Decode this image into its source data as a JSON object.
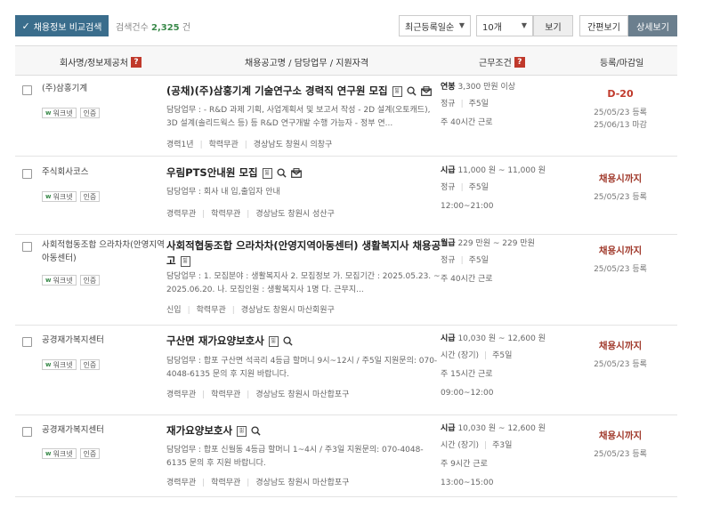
{
  "toolbar": {
    "compare_button": "채용정보 비교검색",
    "count_label": "검색건수",
    "count_value": "2,325",
    "count_unit": "건",
    "sort_select": "최근등록일순",
    "per_page_select": "10개",
    "view_button": "보기",
    "simple_view": "간편보기",
    "detail_view": "상세보기"
  },
  "headers": {
    "company": "회사명/정보제공처",
    "title": "채용공고명 / 담당업무 / 지원자격",
    "conditions": "근무조건",
    "dates": "등록/마감일",
    "help": "?"
  },
  "badges": {
    "worknet": "워크넷",
    "cert": "인증",
    "worknet_mark": "w",
    "doc_mark": "핆"
  },
  "rows": [
    {
      "company": "(주)삼홍기계",
      "title": "(공채)(주)삼홍기계 기술연구소 경력직 연구원 모집",
      "duty": "담당업무 : - R&D 과제 기획, 사업계획서 및 보고서 작성 - 2D 설계(오토캐드), 3D 설계(솔리드웍스 등) 등 R&D 연구개발 수행 가능자 - 정부 연...",
      "meta": [
        "경력1년",
        "학력무관",
        "경상남도 창원시 의창구"
      ],
      "pay_type": "연봉",
      "pay": "3,300 만원 이상",
      "lines": [
        [
          "정규",
          "주5일"
        ],
        [
          "주 40시간 근로"
        ]
      ],
      "status": "D-20",
      "reg": "25/05/23 등록",
      "close": "25/06/13 마감"
    },
    {
      "company": "주식회사코스",
      "title": "우림PTS안내원 모집",
      "duty": "담당업무 : 회사 내 입,출입자 안내",
      "meta": [
        "경력무관",
        "학력무관",
        "경상남도 창원시 성산구"
      ],
      "pay_type": "시급",
      "pay": "11,000 원 ~ 11,000 원",
      "lines": [
        [
          "정규",
          "주5일"
        ],
        [
          "12:00~21:00"
        ]
      ],
      "status": "채용시까지",
      "reg": "25/05/23 등록"
    },
    {
      "company": "사회적협동조합 으라차차(안영지역아동센터)",
      "title": "사회적협동조합 으라차차(안영지역아동센터) 생활복지사 채용공고",
      "duty": "담당업무 : 1. 모집분야 : 생활복지사 2. 모집정보 가. 모집기간 : 2025.05.23. ~ 2025.06.20. 나. 모집인원 : 생활복지사 1명 다. 근무지...",
      "meta": [
        "신입",
        "학력무관",
        "경상남도 창원시 마산회원구"
      ],
      "pay_type": "월급",
      "pay": "229 만원 ~ 229 만원",
      "lines": [
        [
          "정규",
          "주5일"
        ],
        [
          "주 40시간 근로"
        ]
      ],
      "status": "채용시까지",
      "reg": "25/05/23 등록"
    },
    {
      "company": "공경재가복지센터",
      "title": "구산면 재가요양보호사",
      "duty": "담당업무 : 합포 구산면 석곡리 4등급 할머니 9시~12시 / 주5일 지원문의: 070-4048-6135 문의 후 지원 바랍니다.",
      "meta": [
        "경력무관",
        "학력무관",
        "경상남도 창원시 마산합포구"
      ],
      "pay_type": "시급",
      "pay": "10,030 원 ~ 12,600 원",
      "lines": [
        [
          "시간 (장기)",
          "주5일"
        ],
        [
          "주 15시간 근로"
        ],
        [
          "09:00~12:00"
        ]
      ],
      "status": "채용시까지",
      "reg": "25/05/23 등록"
    },
    {
      "company": "공경재가복지센터",
      "title": "재가요양보호사",
      "duty": "담당업무 : 합포 신월동 4등급 할머니 1~4시 / 주3일 지원문의: 070-4048-6135 문의 후 지원 바랍니다.",
      "meta": [
        "경력무관",
        "학력무관",
        "경상남도 창원시 마산합포구"
      ],
      "pay_type": "시급",
      "pay": "10,030 원 ~ 12,600 원",
      "lines": [
        [
          "시간 (장기)",
          "주3일"
        ],
        [
          "주 9시간 근로"
        ],
        [
          "13:00~15:00"
        ]
      ],
      "status": "채용시까지",
      "reg": "25/05/23 등록"
    }
  ]
}
